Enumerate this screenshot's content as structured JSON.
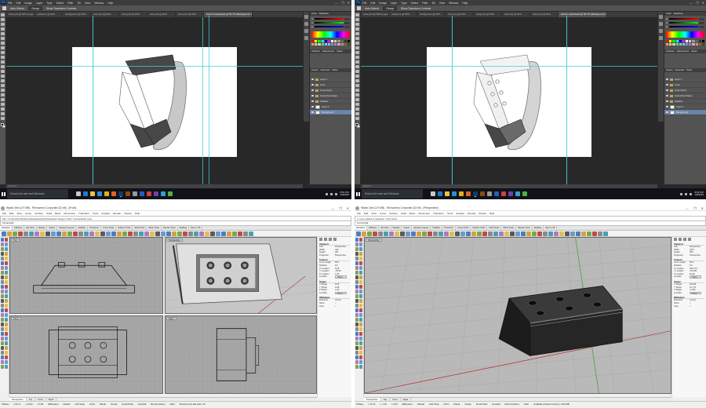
{
  "photoshop": {
    "logo": "Ps",
    "menu": [
      "File",
      "Edit",
      "Image",
      "Layer",
      "Type",
      "Select",
      "Filter",
      "3D",
      "View",
      "Window",
      "Help"
    ],
    "window_controls": [
      "—",
      "❐",
      "✕"
    ],
    "options": {
      "auto_select": "Auto-Select:",
      "auto_select_value": "Group",
      "show_transform": "Show Transform Controls"
    },
    "tabs_left": [
      {
        "label": "back.psd @ 50% (Layer 1, RGB/8)"
      },
      {
        "label": "untitled-1 @ 50%"
      },
      {
        "label": "background @ 50%"
      },
      {
        "label": "front.psd @ 50%"
      },
      {
        "label": "strap.psd @ 50%"
      },
      {
        "label": "side.psd @ 50%"
      },
      {
        "label": "band.psd @ 50%"
      },
      {
        "label": "back to sketchpad @ 66.7% (Background, RGB/8)",
        "active": true
      }
    ],
    "tabs_right": [
      {
        "label": "back.psd @ 50% (Layer 1, RGB/8)"
      },
      {
        "label": "untitled-1 @ 50%"
      },
      {
        "label": "background @ 50%"
      },
      {
        "label": "front.psd @ 50%"
      },
      {
        "label": "strap.psd @ 50%"
      },
      {
        "label": "side.psd @ 50%"
      },
      {
        "label": "band.psd @ 50%"
      },
      {
        "label": "back to sketchpad @ 66.7% (Background, RGB/8)",
        "active": true
      }
    ],
    "status": "66.67%",
    "panel_tabs_color": [
      "Color",
      "Swatches"
    ],
    "panel_tabs_layers": [
      "Layers",
      "Channels",
      "Paths"
    ],
    "panel_tabs_adjust": [
      "Libraries",
      "Adjustments",
      "Styles"
    ],
    "color_labels": [
      "R",
      "G",
      "B"
    ],
    "layers_left": [
      {
        "name": "Layer 1",
        "type": "folder"
      },
      {
        "name": "Lines",
        "type": "folder"
      },
      {
        "name": "Lines (front)",
        "type": "folder"
      },
      {
        "name": "Lines (front base)",
        "type": "folder"
      },
      {
        "name": "Shadow",
        "type": "folder"
      },
      {
        "name": "Layer 0",
        "type": "thumb"
      },
      {
        "name": "Background",
        "type": "thumb",
        "selected": true
      }
    ],
    "layers_right": [
      {
        "name": "Layer 1",
        "type": "folder"
      },
      {
        "name": "Lines",
        "type": "folder"
      },
      {
        "name": "Lines (front)",
        "type": "folder"
      },
      {
        "name": "Lines (front base)",
        "type": "folder"
      },
      {
        "name": "Shadow",
        "type": "folder"
      },
      {
        "name": "Layer 0",
        "type": "thumb"
      },
      {
        "name": "Background",
        "type": "thumb",
        "selected": true
      }
    ]
  },
  "taskbar": {
    "search_placeholder": "Search the web and Windows",
    "clock_time": "8:51 PM",
    "clock_date": "1/8/2016",
    "clock_time_2": "8:52 PM",
    "clock_date_2": "1/8/2016"
  },
  "rhino_left": {
    "title": "Watch.3dm (2.9 MB) - Rhinoceros Corporate (32-bit) - [Front]",
    "window_controls": [
      "—",
      "❐",
      "✕"
    ],
    "menu": [
      "File",
      "Edit",
      "View",
      "Curve",
      "Surface",
      "Solid",
      "Mesh",
      "Dimension",
      "Transform",
      "Tools",
      "Analyze",
      "Render",
      "Panels",
      "Help"
    ],
    "cmd_history": "File \"C:\\Users\\frontbottom\\Desktop\\watch\\final\\watch design 2.3dm\" successfully read",
    "cmd_prompt": "Command:",
    "tabs": [
      "Standard",
      "CPlanes",
      "Set View",
      "Display",
      "Select",
      "Viewport Layout",
      "Visibility",
      "Transform",
      "Curve Tools",
      "Surface Tools",
      "Solid Tools",
      "Mesh Tools",
      "Render Tools",
      "Drafting",
      "New in V5"
    ],
    "viewports": [
      "Top",
      "Perspective",
      "Front",
      "Right"
    ],
    "view_tabs": [
      "Perspective",
      "Top",
      "Front",
      "Right"
    ],
    "status": [
      "CPlane",
      "x 62.17",
      "y 10.03",
      "z 0.00",
      "Millimeters",
      "Default",
      "Grid Snap",
      "Ortho",
      "Planar",
      "Osnap",
      "SmartTrack",
      "Gumball",
      "Record History",
      "Filter",
      "Minutes from last save: 10"
    ],
    "props": {
      "section_viewport": "Viewport",
      "section_camera": "Camera",
      "section_target": "Target",
      "section_wallpaper": "Wallpaper",
      "rows_viewport": [
        [
          "Title",
          "Perspective"
        ],
        [
          "Width",
          "420"
        ],
        [
          "Height",
          "261"
        ],
        [
          "Projection",
          "Perspective"
        ]
      ],
      "rows_camera": [
        [
          "Lens Length",
          "50.0"
        ],
        [
          "Rotation",
          "0.0"
        ],
        [
          "X Location",
          "9.28"
        ],
        [
          "Y Location",
          "-78.52"
        ],
        [
          "Z Location",
          "4.18"
        ],
        [
          "Location",
          "Place..."
        ]
      ],
      "rows_target": [
        [
          "X Target",
          "9.28"
        ],
        [
          "Y Target",
          "9.28"
        ],
        [
          "Z Target",
          "4.18"
        ],
        [
          "Location",
          "Place..."
        ]
      ],
      "rows_wallpaper": [
        [
          "Filename",
          "(none)"
        ],
        [
          "Show",
          "✓"
        ],
        [
          "Gray",
          "✓"
        ]
      ]
    }
  },
  "rhino_right": {
    "title": "Watch.3dm (2.9 MB) - Rhinoceros Corporate (32-bit) - [Perspective]",
    "window_controls": [
      "—",
      "❐",
      "✕"
    ],
    "menu": [
      "File",
      "Edit",
      "View",
      "Curve",
      "Surface",
      "Solid",
      "Mesh",
      "Dimension",
      "Transform",
      "Tools",
      "Analyze",
      "Render",
      "Panels",
      "Help"
    ],
    "cmd_history": "1 curve added to selection. Command:",
    "cmd_prompt": "Command:",
    "tabs": [
      "Standard",
      "CPlanes",
      "Set View",
      "Display",
      "Select",
      "Viewport Layout",
      "Visibility",
      "Transform",
      "Curve Tools",
      "Surface Tools",
      "Solid Tools",
      "Mesh Tools",
      "Render Tools",
      "Drafting",
      "New in V5"
    ],
    "viewport": "Perspective",
    "view_tabs": [
      "Perspective",
      "Top",
      "Front",
      "Right"
    ],
    "status": [
      "CPlane",
      "x 70.12",
      "y -7.91",
      "z 0.00",
      "Millimeters",
      "Default",
      "Grid Snap",
      "Ortho",
      "Planar",
      "Osnap",
      "SmartTrack",
      "Gumball",
      "Record History",
      "Filter",
      "Available physical memory: 1110 MB"
    ],
    "props": {
      "section_viewport": "Viewport",
      "section_camera": "Camera",
      "section_target": "Target",
      "section_wallpaper": "Wallpaper",
      "rows_viewport": [
        [
          "Title",
          "Perspective"
        ],
        [
          "Width",
          "1057"
        ],
        [
          "Height",
          "559"
        ],
        [
          "Projection",
          "Perspective"
        ]
      ],
      "rows_camera": [
        [
          "Lens Length",
          "50.0"
        ],
        [
          "Rotation",
          "0.0"
        ],
        [
          "X Location",
          "108.775"
        ],
        [
          "Y Location",
          "-81.683"
        ],
        [
          "Z Location",
          "54.93"
        ],
        [
          "Location",
          "Place..."
        ]
      ],
      "rows_target": [
        [
          "X Target",
          "28.466"
        ],
        [
          "Y Target",
          "10.774"
        ],
        [
          "Z Target",
          "-4.256"
        ],
        [
          "Location",
          "Place..."
        ]
      ],
      "rows_wallpaper": [
        [
          "Filename",
          "(none)"
        ],
        [
          "Show",
          "✓"
        ],
        [
          "Gray",
          "✓"
        ]
      ]
    }
  },
  "colors": {
    "ps_bg": "#282828",
    "ps_panel": "#535353",
    "guide": "#3fd0d0",
    "rhino_viewport": "#a6a6a6",
    "grid_x_axis": "#b03030",
    "grid_y_axis": "#30a030",
    "watch_dark": "#4a4a4a",
    "watch_light": "#bdbdbd"
  }
}
